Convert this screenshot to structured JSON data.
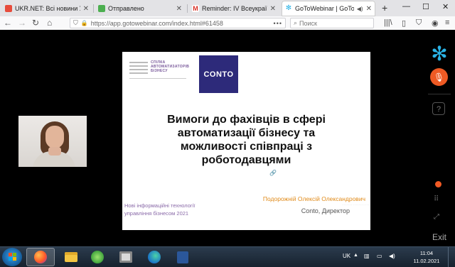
{
  "browser": {
    "tabs": [
      {
        "title": "UKR.NET: Всі новини Украї",
        "favicon_color": "#e74c3c",
        "active": false
      },
      {
        "title": "Отправлено",
        "favicon_color": "#4caf50",
        "active": false
      },
      {
        "title": "Reminder: IV Всеукраїнськ",
        "favicon_color": "#d93025",
        "active": false
      },
      {
        "title": "GoToWebinar | GoToWe",
        "favicon_color": "#2ab3e6",
        "active": true
      }
    ],
    "newtab_icon": "+",
    "window_controls": [
      "—",
      "☐",
      "✕"
    ],
    "url": "https://app.gotowebinar.com/index.html#61458",
    "url_more": "•••",
    "search_placeholder": "Поиск"
  },
  "slide": {
    "logo_left_text": "СПІЛКА\nАВТОМАТИЗАТОРІВ\nБІЗНЕСУ",
    "logo_right_text": "CONTO",
    "title": "Вимоги до фахівців в сфері автоматизації бізнесу та можливості співпраці з роботодавцями",
    "conference": "Нові інформаційні технології управління бізнесом 2021",
    "speaker": "Подорожній Олексій Олександрович",
    "company": "Conto, Директор"
  },
  "sidebar": {
    "exit_label": "Exit",
    "accent_color": "#2ab3e6",
    "mic_color": "#ee5a24"
  },
  "taskbar": {
    "language": "UK",
    "time": "11:04",
    "date": "11.02.2021"
  }
}
